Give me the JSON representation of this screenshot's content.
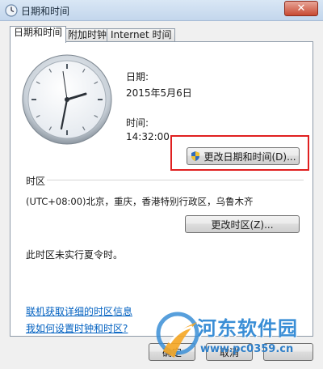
{
  "window": {
    "title": "日期和时间",
    "close_label": "✕"
  },
  "tabs": [
    {
      "label": "日期和时间",
      "active": true
    },
    {
      "label": "附加时钟",
      "active": false
    },
    {
      "label": "Internet 时间",
      "active": false
    }
  ],
  "datetime": {
    "date_label": "日期:",
    "date_value": "2015年5月6日",
    "time_label": "时间:",
    "time_value": "14:32:00",
    "change_button": "更改日期和时间(D)..."
  },
  "timezone": {
    "section_label": "时区",
    "value": "(UTC+08:00)北京，重庆，香港特别行政区，乌鲁木齐",
    "change_button": "更改时区(Z)...",
    "dst_note": "此时区未实行夏令时。"
  },
  "links": {
    "online_info": "联机获取详细的时区信息",
    "how_to_set": "我如何设置时钟和时区?"
  },
  "footer": {
    "ok_label": "确定",
    "cancel_label": "取消"
  },
  "watermark": {
    "brand": "河东软件园",
    "url": "www.pc0359.cn"
  },
  "colors": {
    "highlight_box": "#e02020",
    "link": "#0060c0",
    "watermark": "#3a8ed6"
  }
}
